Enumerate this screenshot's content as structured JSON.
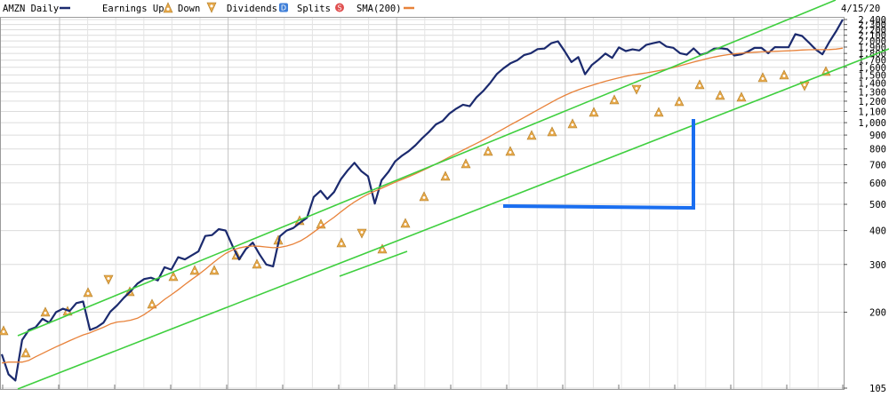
{
  "header": {
    "ticker_label": "AMZN Daily",
    "earnings_label": "Earnings Up",
    "down_label": "Down",
    "dividends_label": "Dividends",
    "dividends_marker": "D",
    "splits_label": "Splits",
    "splits_marker": "S",
    "sma_label": "SMA(200)",
    "date_label": "4/15/20"
  },
  "colors": {
    "price_line": "#1b2a6e",
    "sma_line": "#e8823a",
    "trend_channel": "#3fcf3f",
    "annotation": "#1a6ef0",
    "earnings_up_marker": "#e6a84a",
    "dividends_badge": "#3f7fd8",
    "splits_badge": "#e05050"
  },
  "chart_data": {
    "type": "line",
    "title": "",
    "xlabel": "",
    "ylabel": "",
    "y_scale": "log",
    "ylim": [
      105,
      2400
    ],
    "yticks": [
      "105",
      "200",
      "300",
      "400",
      "500",
      "600",
      "700",
      "800",
      "900",
      "1,000",
      "1,100",
      "1,200",
      "1,300",
      "1,400",
      "1,500",
      "1,600",
      "1,700",
      "1,800",
      "1,900",
      "2,000",
      "2,100",
      "2,200",
      "2,300",
      "2,400"
    ],
    "grid": true,
    "legend": "top",
    "series": [
      {
        "name": "AMZN Daily",
        "values": [
          140,
          118,
          112,
          158,
          172,
          176,
          189,
          183,
          200,
          206,
          202,
          216,
          219,
          172,
          176,
          183,
          201,
          212,
          226,
          239,
          255,
          265,
          268,
          262,
          293,
          287,
          319,
          313,
          324,
          335,
          382,
          385,
          405,
          400,
          352,
          313,
          342,
          361,
          327,
          300,
          295,
          381,
          400,
          409,
          428,
          446,
          532,
          561,
          523,
          555,
          619,
          667,
          711,
          663,
          634,
          503,
          613,
          658,
          720,
          755,
          785,
          826,
          877,
          925,
          985,
          1015,
          1080,
          1126,
          1165,
          1150,
          1240,
          1310,
          1400,
          1512,
          1588,
          1655,
          1698,
          1774,
          1804,
          1867,
          1876,
          1962,
          1995,
          1834,
          1672,
          1745,
          1508,
          1631,
          1708,
          1798,
          1733,
          1894,
          1836,
          1863,
          1846,
          1934,
          1962,
          1986,
          1908,
          1888,
          1804,
          1780,
          1879,
          1778,
          1807,
          1873,
          1881,
          1865,
          1768,
          1786,
          1828,
          1887,
          1887,
          1803,
          1898,
          1897,
          1897,
          2119,
          2088,
          1974,
          1861,
          1787,
          1980,
          2170,
          2400
        ]
      },
      {
        "name": "SMA(200)",
        "values": [
          130,
          131,
          131,
          131,
          133,
          137,
          141,
          145,
          149,
          153,
          157,
          161,
          165,
          168,
          172,
          176,
          181,
          184,
          185,
          187,
          190,
          196,
          204,
          213,
          223,
          232,
          242,
          253,
          264,
          275,
          288,
          302,
          316,
          329,
          339,
          345,
          349,
          351,
          350,
          348,
          346,
          347,
          351,
          357,
          366,
          379,
          395,
          412,
          430,
          448,
          469,
          490,
          510,
          528,
          545,
          559,
          573,
          588,
          603,
          617,
          632,
          648,
          665,
          684,
          704,
          725,
          747,
          769,
          792,
          815,
          839,
          864,
          891,
          920,
          950,
          981,
          1012,
          1045,
          1079,
          1114,
          1150,
          1188,
          1225,
          1260,
          1292,
          1322,
          1348,
          1373,
          1397,
          1421,
          1443,
          1464,
          1482,
          1499,
          1513,
          1526,
          1540,
          1557,
          1575,
          1596,
          1621,
          1646,
          1672,
          1697,
          1722,
          1745,
          1765,
          1780,
          1793,
          1803,
          1811,
          1818,
          1824,
          1828,
          1832,
          1836,
          1840,
          1846,
          1853,
          1857,
          1858,
          1858,
          1860,
          1867,
          1882
        ]
      }
    ]
  }
}
